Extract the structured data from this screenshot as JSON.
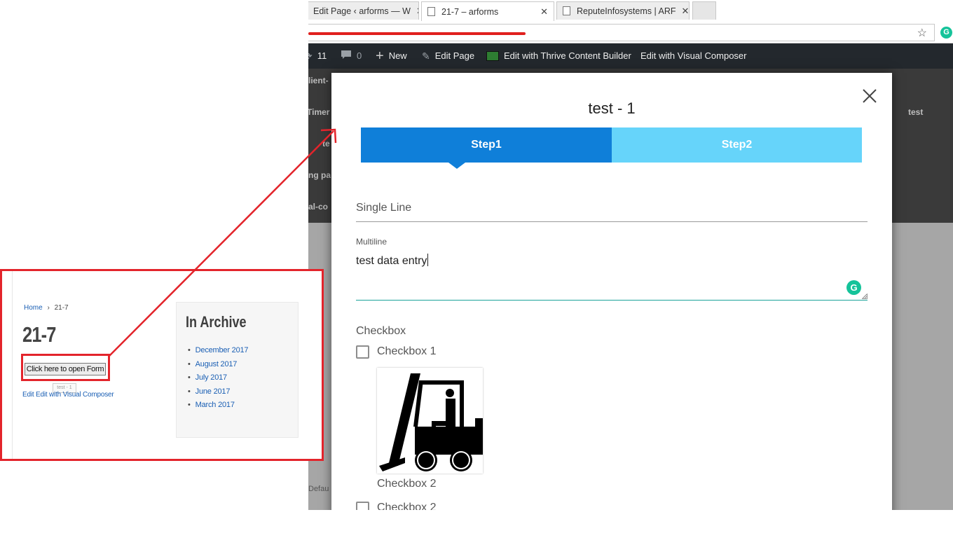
{
  "browser": {
    "tabs": [
      {
        "title": "Edit Page ‹ arforms — W",
        "active": false
      },
      {
        "title": "21-7 – arforms",
        "active": true
      },
      {
        "title": "ReputeInfosystems | ARF",
        "active": false
      }
    ],
    "tab_close_glyph": "✕",
    "star_icon": "☆",
    "extension_icon": "G"
  },
  "admin_bar": {
    "updates_count": "11",
    "comments_count": "0",
    "new_label": "New",
    "edit_page_label": "Edit Page",
    "thrive_label": "Edit with Thrive Content Builder",
    "visual_composer_label": "Edit with Visual Composer"
  },
  "background_fragments": {
    "f1": "lient-",
    "f2": "Timer",
    "f3": "test",
    "f4": "te",
    "f5": "ng pa",
    "f6": "al-co",
    "f7": "Defau"
  },
  "modal": {
    "title": "test - 1",
    "close_icon": "close-icon",
    "steps": [
      {
        "label": "Step1",
        "active": true,
        "color": "#0f7fd9"
      },
      {
        "label": "Step2",
        "active": false,
        "color": "#66d4fa"
      }
    ],
    "single_line": {
      "placeholder": "Single Line",
      "value": ""
    },
    "multiline": {
      "label": "Multiline",
      "value": "test data entry"
    },
    "grammar_badge": "G",
    "checkbox_group": {
      "label": "Checkbox",
      "options": [
        {
          "label": "Checkbox 1",
          "checked": false
        },
        {
          "image": "forklift-image",
          "caption": "Checkbox 2"
        },
        {
          "label": "Checkbox 2",
          "checked": false
        }
      ]
    }
  },
  "left_page": {
    "breadcrumb_home": "Home",
    "breadcrumb_sep": "›",
    "breadcrumb_current": "21-7",
    "title": "21-7",
    "open_button": "Click here to open Form",
    "tooltip": "test - 1",
    "edit_links": "Edit Edit with Visual Composer",
    "archive_title": "In Archive",
    "archive_items": [
      "December 2017",
      "August 2017",
      "July 2017",
      "June 2017",
      "March 2017"
    ]
  },
  "colors": {
    "annotation_red": "#e3242b",
    "step_active": "#0f7fd9",
    "step_inactive": "#66d4fa",
    "admin_bar": "#23282d",
    "grammarly": "#15c39a"
  }
}
